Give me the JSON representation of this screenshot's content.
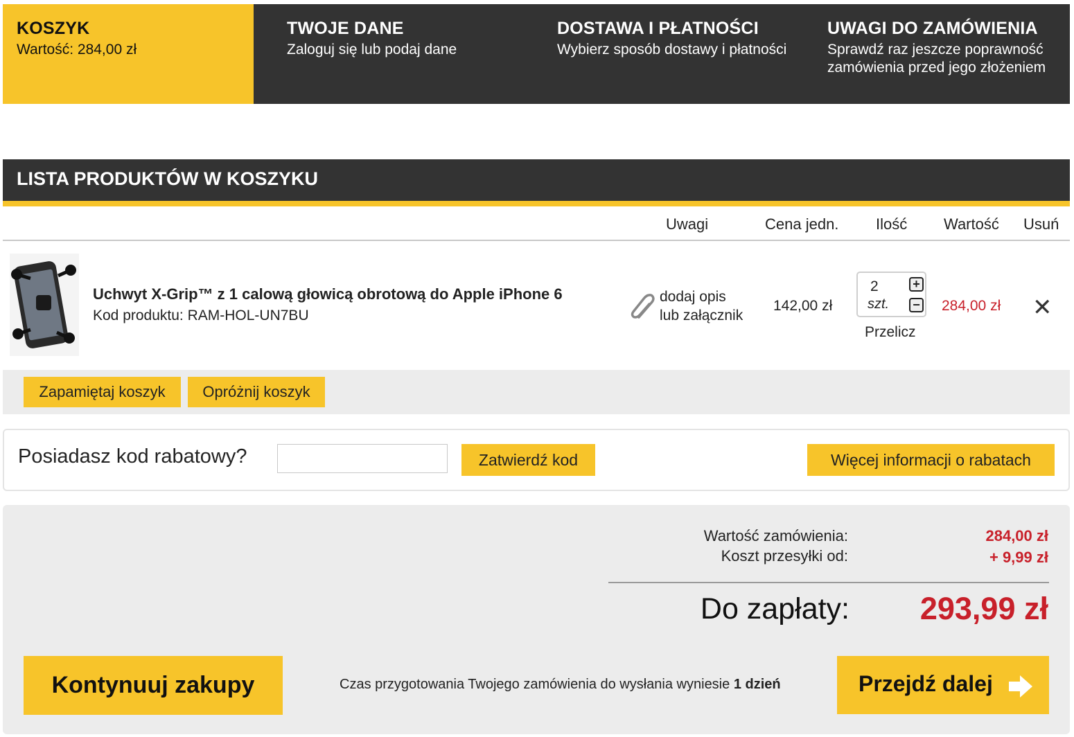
{
  "steps": [
    {
      "title": "KOSZYK",
      "desc": "Wartość: 284,00 zł"
    },
    {
      "title": "TWOJE DANE",
      "desc": "Zaloguj się lub podaj dane"
    },
    {
      "title": "DOSTAWA I PŁATNOŚCI",
      "desc": "Wybierz sposób dostawy i płatności"
    },
    {
      "title": "UWAGI DO ZAMÓWIENIA",
      "desc": "Sprawdź raz jeszcze poprawność zamówienia przed jego złożeniem"
    }
  ],
  "cart": {
    "header": "LISTA PRODUKTÓW W KOSZYKU",
    "columns": {
      "notes": "Uwagi",
      "unit_price": "Cena jedn.",
      "qty": "Ilość",
      "value": "Wartość",
      "remove": "Usuń"
    },
    "items": [
      {
        "name": "Uchwyt X-Grip™ z 1 calową głowicą obrotową do Apple iPhone 6",
        "code": "Kod produktu: RAM-HOL-UN7BU",
        "note_link_line1": "dodaj opis",
        "note_link_line2": "lub załącznik",
        "unit_price": "142,00 zł",
        "qty": "2",
        "qty_unit": "szt.",
        "recalc": "Przelicz",
        "total": "284,00 zł",
        "remove_icon": "close-icon"
      }
    ],
    "save_label": "Zapamiętaj koszyk",
    "empty_label": "Opróżnij koszyk"
  },
  "coupon": {
    "label": "Posiadasz kod rabatowy?",
    "value": "",
    "apply_label": "Zatwierdź kod",
    "more_label": "Więcej informacji o rabatach"
  },
  "summary": {
    "order_value_label": "Wartość zamówienia:",
    "order_value": "284,00 zł",
    "shipping_label": "Koszt przesyłki od:",
    "shipping_value": "+ 9,99 zł",
    "total_label": "Do zapłaty:",
    "total_value": "293,99 zł",
    "continue_label": "Kontynuuj zakupy",
    "prep_text": "Czas przygotowania Twojego zamówienia do wysłania wyniesie",
    "prep_days": "1 dzień",
    "next_label": "Przejdź dalej"
  },
  "colors": {
    "accent": "#f7c42a",
    "dark": "#333333",
    "price_red": "#c8202a",
    "panel_gray": "#ececec"
  }
}
